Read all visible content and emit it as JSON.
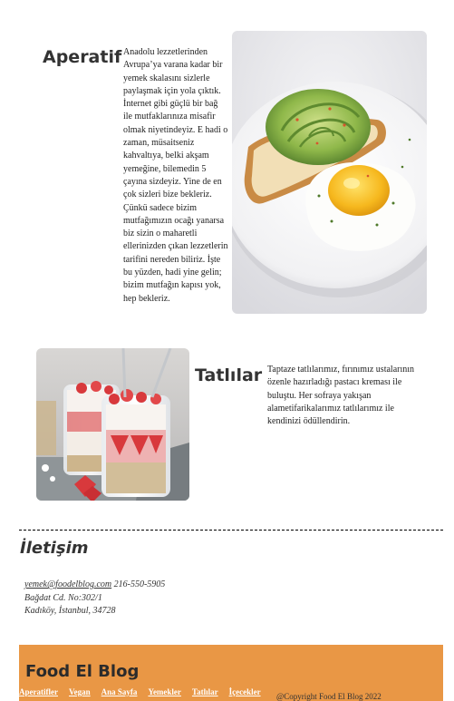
{
  "aperatif": {
    "title": "Aperatif",
    "text": "Anadolu lezzetlerinden Avrupa’ya varana kadar bir yemek skalasını sizlerle paylaşmak için yola çıktık. İnternet gibi güçlü bir bağ ile mutfaklarınıza misafir olmak niyetindeyiz. E hadi o zaman, müsaitseniz kahvaltıya, belki akşam yemeğine, bilemedin 5 çayına sizdeyiz. Yine de en çok sizleri bize bekleriz. Çünkü sadece bizim mutfağımızın ocağı yanarsa biz sizin o maharetli ellerinizden çıkan lezzetlerin tarifini nereden biliriz. İşte bu yüzden, hadi yine gelin; bizim mutfağın kapısı yok, hep bekleriz."
  },
  "tatlilar": {
    "title": "Tatlılar",
    "text": "Taptaze tatlılarımız, fırınımız ustalarının özenle hazırladığı pastacı kreması ile buluştu. Her sofraya yakışan alametifarikalarımız tatlılarımız ile kendinizi ödüllendirin."
  },
  "contact": {
    "title": "İletişim",
    "email": "yemek@foodelblog.com",
    "phone": "216-550-5905",
    "address_line1": "Bağdat Cd. No:302/1",
    "address_line2": "Kadıköy, İstanbul, 34728"
  },
  "footer": {
    "title": "Food El Blog",
    "nav": [
      "Aperatifler",
      "Vegan",
      "Ana Sayfa",
      "Yemekler",
      "Tatlılar",
      "İçecekler"
    ],
    "copyright": "@Copyright Food El Blog 2022"
  },
  "colors": {
    "footer_bg": "#e99745",
    "footer_link": "#ffffff"
  },
  "icons": {
    "aperatif_image": "avocado-toast-egg-image",
    "tatlilar_image": "strawberry-parfait-jars-image"
  }
}
